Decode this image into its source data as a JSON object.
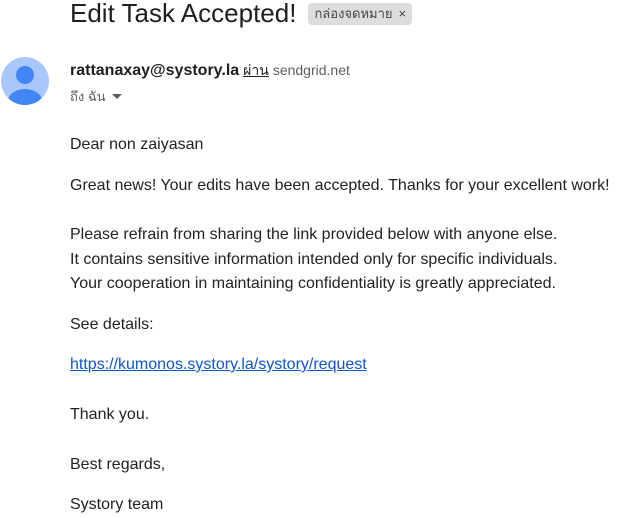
{
  "email": {
    "subject": "Edit Task Accepted!",
    "label_chip": "กล่องจดหมาย",
    "label_chip_close": "×",
    "sender_email": "rattanaxay@systory.la",
    "via_word": "ผ่าน",
    "via_domain": "sendgrid.net",
    "to_text": "ถึง ฉัน",
    "body": {
      "greeting": "Dear non zaiyasan",
      "news": "Great news! Your edits have been accepted. Thanks for your excellent work!",
      "refrain_1": "Please refrain from sharing the link provided below with anyone else.",
      "refrain_2": "It contains sensitive information intended only for specific individuals.",
      "refrain_3": "Your cooperation in maintaining confidentiality is greatly appreciated.",
      "see_details": "See details:",
      "link": "https://kumonos.systory.la/systory/request",
      "thanks": "Thank you.",
      "regards": "Best regards,",
      "signature": "Systory team"
    }
  },
  "colors": {
    "avatar_bg": "#a8c7fa",
    "avatar_fg": "#4285f4",
    "link": "#1155cc",
    "chip_bg": "#dddddd"
  }
}
